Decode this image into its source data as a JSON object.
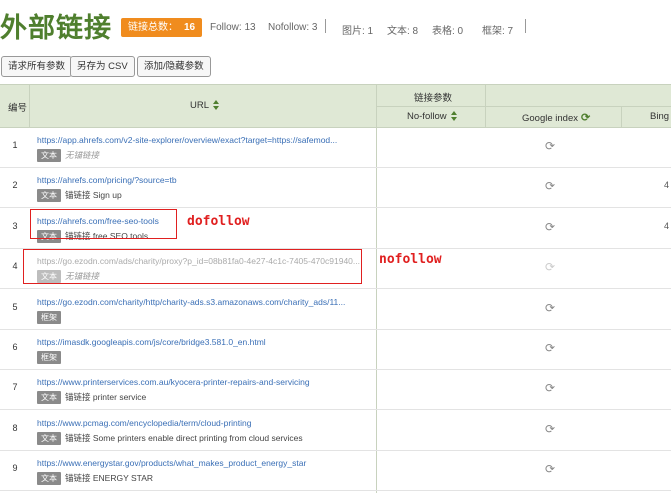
{
  "header": {
    "title": "外部链接",
    "total_label": "链接总数：",
    "total_value": "16",
    "stats": [
      "Follow: 13",
      "Nofollow: 3",
      "图片: 1",
      "文本: 8",
      "表格: 0",
      "框架: 7"
    ]
  },
  "toolbar": {
    "request_params": "请求所有参数",
    "save_csv": "另存为 CSV",
    "add_hide_params": "添加/隐藏参数"
  },
  "table": {
    "col_num": "编号",
    "col_url": "URL",
    "group_link_params": "链接参数",
    "col_nofollow": "No-follow",
    "col_google_index": "Google index",
    "col_bing": "Bing i",
    "rows": [
      {
        "num": "1",
        "url": "https://app.ahrefs.com/v2-site-explorer/overview/exact?target=https://safemod...",
        "tag": "文本",
        "anchor": "无锚链接",
        "empty": true,
        "dim": false,
        "bing": ""
      },
      {
        "num": "2",
        "url": "https://ahrefs.com/pricing/?source=tb",
        "tag": "文本",
        "anchor": "锚链接 Sign up",
        "empty": false,
        "dim": false,
        "bing": "4"
      },
      {
        "num": "3",
        "url": "https://ahrefs.com/free-seo-tools",
        "tag": "文本",
        "anchor": "锚链接 free SEO tools",
        "empty": false,
        "dim": false,
        "bing": "4"
      },
      {
        "num": "4",
        "url": "https://go.ezodn.com/ads/charity/proxy?p_id=08b81fa0-4e27-4c1c-7405-470c91940...",
        "tag": "文本",
        "anchor": "无锚链接",
        "empty": true,
        "dim": true,
        "bing": ""
      },
      {
        "num": "5",
        "url": "https://go.ezodn.com/charity/http/charity-ads.s3.amazonaws.com/charity_ads/11...",
        "tag": "框架",
        "anchor": "",
        "empty": false,
        "dim": false,
        "bing": ""
      },
      {
        "num": "6",
        "url": "https://imasdk.googleapis.com/js/core/bridge3.581.0_en.html",
        "tag": "框架",
        "anchor": "",
        "empty": false,
        "dim": false,
        "bing": ""
      },
      {
        "num": "7",
        "url": "https://www.printerservices.com.au/kyocera-printer-repairs-and-servicing",
        "tag": "文本",
        "anchor": "锚链接 printer service",
        "empty": false,
        "dim": false,
        "bing": ""
      },
      {
        "num": "8",
        "url": "https://www.pcmag.com/encyclopedia/term/cloud-printing",
        "tag": "文本",
        "anchor": "锚链接 Some printers enable direct printing from cloud services",
        "empty": false,
        "dim": false,
        "bing": ""
      },
      {
        "num": "9",
        "url": "https://www.energystar.gov/products/what_makes_product_energy_star",
        "tag": "文本",
        "anchor": "锚链接 ENERGY STAR",
        "empty": false,
        "dim": false,
        "bing": ""
      }
    ]
  },
  "annotations": {
    "dofollow": "dofollow",
    "nofollow": "nofollow"
  },
  "colors": {
    "brand_green": "#4f7f2e",
    "badge_orange": "#f08c1e",
    "annotation_red": "#e02020",
    "link_blue": "#3a6fb6"
  },
  "icons": {
    "refresh": "refresh-icon",
    "sort": "sort-icon"
  }
}
